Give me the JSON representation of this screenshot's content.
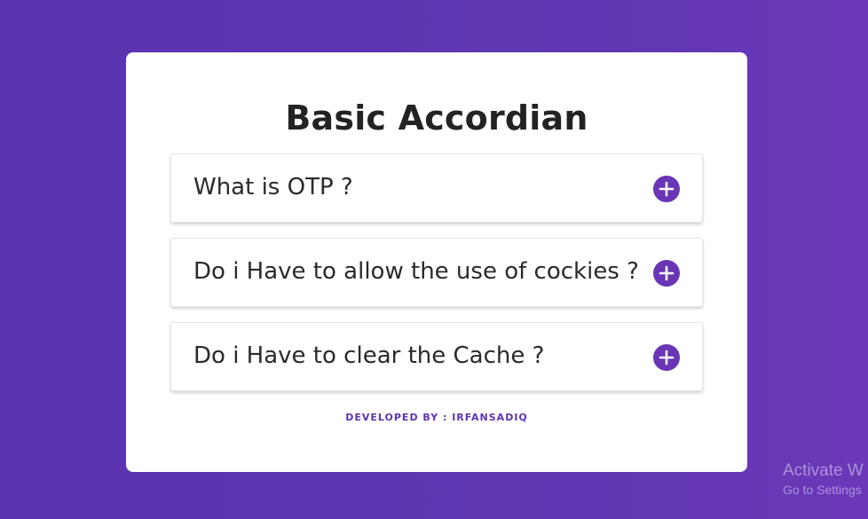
{
  "page": {
    "title": "Basic Accordian",
    "footer": "DEVELOPED BY : IRFANSADIQ"
  },
  "accordion": {
    "items": [
      {
        "question": "What is OTP ?",
        "toggle_icon": "plus-circle-icon",
        "expanded": false
      },
      {
        "question": "Do i Have to allow the use of cockies ?",
        "toggle_icon": "plus-circle-icon",
        "expanded": false
      },
      {
        "question": "Do i Have to clear the Cache ?",
        "toggle_icon": "plus-circle-icon",
        "expanded": false
      }
    ]
  },
  "watermark": {
    "line1": "Activate W",
    "line2": "Go to Settings"
  },
  "colors": {
    "background": "#5f35b2",
    "accent": "#6a36b6",
    "card": "#ffffff",
    "text": "#232323"
  }
}
